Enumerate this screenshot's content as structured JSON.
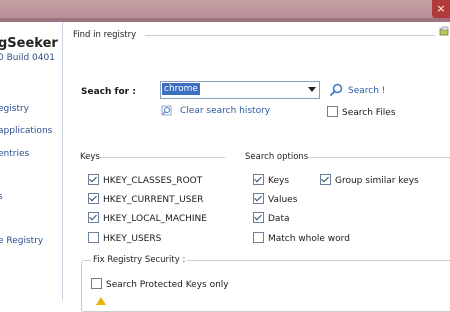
{
  "window": {
    "close_glyph": "×"
  },
  "sidebar": {
    "app_name": "gSeeker",
    "build": "0 Build 0401",
    "items": [
      {
        "label": "egistry"
      },
      {
        "label": " applications"
      },
      {
        "label": "entries"
      },
      {
        "label": "s"
      },
      {
        "label": "e Registry"
      }
    ]
  },
  "main": {
    "find_in_registry": "Find in registry",
    "search_for_label": "Seach for :",
    "search_value": "chrome",
    "search_button": "Search !",
    "search_files_label": "Search Files",
    "clear_history": "Clear search history",
    "keys_section": "Keys",
    "keys": [
      {
        "label": "HKEY_CLASSES_ROOT",
        "checked": true
      },
      {
        "label": "HKEY_CURRENT_USER",
        "checked": true
      },
      {
        "label": "HKEY_LOCAL_MACHINE",
        "checked": true
      },
      {
        "label": "HKEY_USERS",
        "checked": false
      }
    ],
    "search_options_section": "Search options",
    "options": [
      {
        "label": "Keys",
        "checked": true
      },
      {
        "label": "Values",
        "checked": true
      },
      {
        "label": "Data",
        "checked": true
      },
      {
        "label": "Match whole word",
        "checked": false
      }
    ],
    "group_similar_keys": {
      "label": "Group similar keys",
      "checked": true
    },
    "fix_security_section": "Fix Registry Security :",
    "search_protected_label": "Search Protected Keys only",
    "search_protected_checked": false
  },
  "colors": {
    "accent": "#2c5aa8",
    "titlebar": "#b48c93"
  }
}
